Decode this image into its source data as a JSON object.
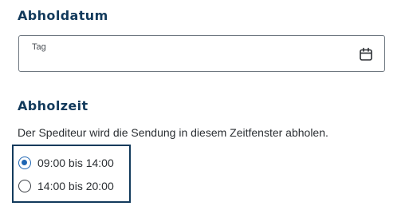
{
  "pickup_date": {
    "heading": "Abholdatum",
    "field_label": "Tag",
    "field_value": "",
    "icon": "calendar-icon"
  },
  "pickup_time": {
    "heading": "Abholzeit",
    "description": "Der Spediteur wird die Sendung in diesem Zeitfenster abholen.",
    "options": [
      {
        "label": "09:00 bis 14:00",
        "selected": true
      },
      {
        "label": "14:00 bis 20:00",
        "selected": false
      }
    ]
  },
  "colors": {
    "heading": "#123a5c",
    "radio_accent": "#1f66b3",
    "focus_border": "#123a5c"
  }
}
